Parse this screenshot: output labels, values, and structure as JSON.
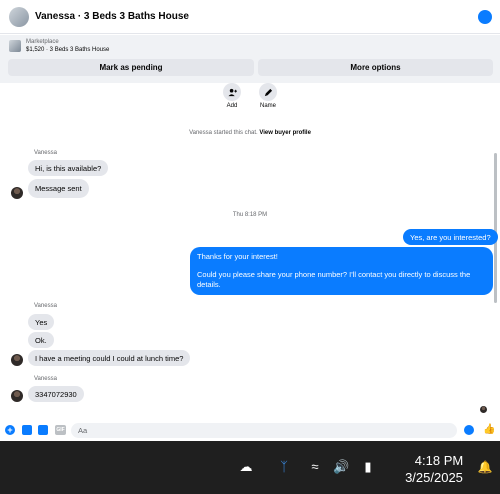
{
  "header": {
    "title": "Vanessa · 3 Beds 3 Baths House"
  },
  "listing": {
    "label": "Marketplace",
    "price_title": "$1,520 · 3 Beds 3 Baths House",
    "mark_pending": "Mark as pending",
    "more_options": "More options"
  },
  "actions": {
    "add": "Add",
    "name": "Name"
  },
  "system": {
    "started": "Vanessa started this chat.",
    "view_profile": "View buyer profile"
  },
  "messages": {
    "sender": "Vanessa",
    "m1": "Hi, is this available?",
    "m2": "Message sent",
    "timestamp": "Thu 8:18 PM",
    "out1": "Yes, are you interested?",
    "out2_line1": "Thanks for your interest!",
    "out2_line2": "Could you please share your phone number? I'll contact you directly to discuss the details.",
    "m3": "Yes",
    "m4": "Ok.",
    "m5": "I have a meeting could I could at lunch time?",
    "m6": "3347072930"
  },
  "composer": {
    "placeholder": "Aa"
  },
  "taskbar": {
    "time": "4:18 PM",
    "date": "3/25/2025"
  },
  "colors": {
    "accent": "#0a7cff",
    "bubble_in": "#e4e6eb",
    "taskbar": "#1f1f1f"
  }
}
